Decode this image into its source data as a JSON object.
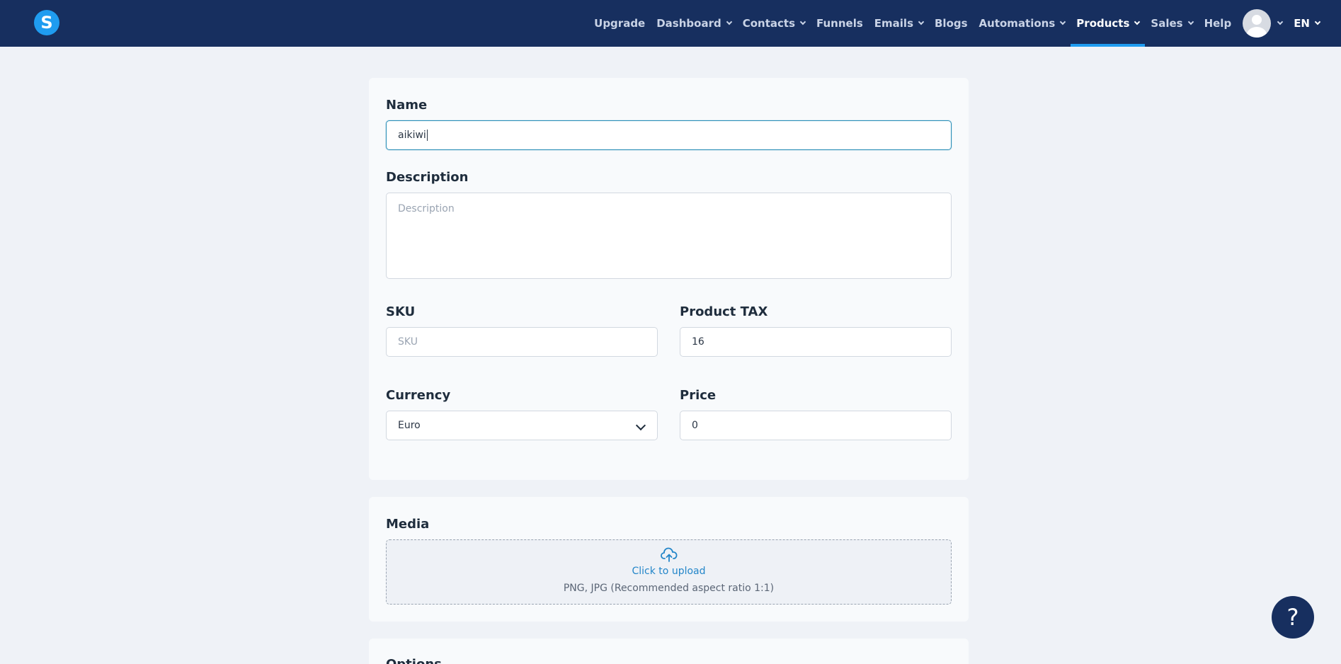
{
  "nav": {
    "logo_letter": "S",
    "items": [
      {
        "label": "Upgrade",
        "dropdown": false
      },
      {
        "label": "Dashboard",
        "dropdown": true
      },
      {
        "label": "Contacts",
        "dropdown": true
      },
      {
        "label": "Funnels",
        "dropdown": false
      },
      {
        "label": "Emails",
        "dropdown": true
      },
      {
        "label": "Blogs",
        "dropdown": false
      },
      {
        "label": "Automations",
        "dropdown": true
      },
      {
        "label": "Products",
        "dropdown": true,
        "active": true
      },
      {
        "label": "Sales",
        "dropdown": true
      },
      {
        "label": "Help",
        "dropdown": false
      }
    ],
    "language": "EN"
  },
  "form": {
    "name_label": "Name",
    "name_value": "aikiwi",
    "description_label": "Description",
    "description_placeholder": "Description",
    "sku_label": "SKU",
    "sku_placeholder": "SKU",
    "tax_label": "Product TAX",
    "tax_value": "16",
    "currency_label": "Currency",
    "currency_value": "Euro",
    "price_label": "Price",
    "price_value": "0"
  },
  "media": {
    "label": "Media",
    "upload_link": "Click to upload",
    "upload_hint": "PNG, JPG (Recommended aspect ratio 1:1)"
  },
  "options": {
    "label": "Options"
  },
  "help_button": "?",
  "colors": {
    "nav_bg": "#172f5f",
    "accent": "#1f9cf0",
    "link": "#2386c9",
    "page_bg": "#eff2f7"
  }
}
